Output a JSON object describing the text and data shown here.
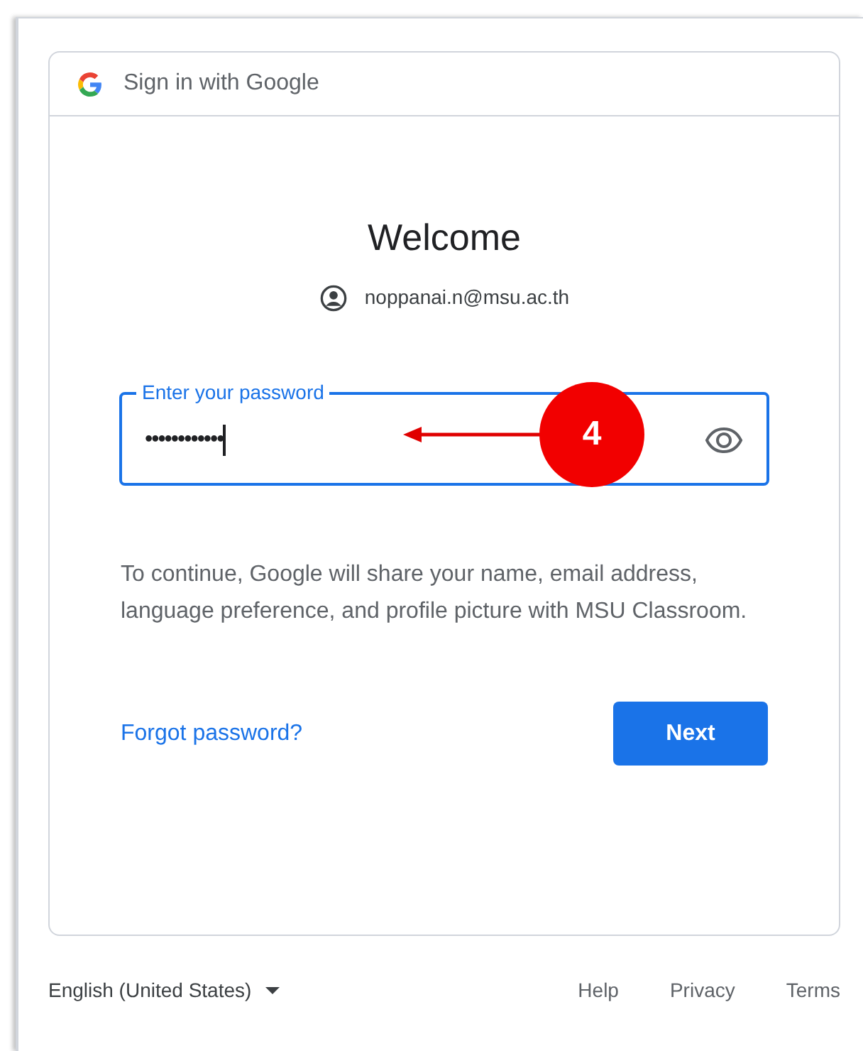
{
  "header": {
    "title": "Sign in with Google"
  },
  "heading": "Welcome",
  "account": {
    "email": "noppanai.n@msu.ac.th"
  },
  "password_field": {
    "label": "Enter your password",
    "value": "••••••••••••",
    "focused": true
  },
  "annotation": {
    "number": "4"
  },
  "notice": "To continue, Google will share your name, email address, language preference, and profile picture with MSU Classroom.",
  "forgot_link": "Forgot password?",
  "next_button": "Next",
  "footer": {
    "language": "English (United States)",
    "links": [
      "Help",
      "Privacy",
      "Terms"
    ]
  }
}
